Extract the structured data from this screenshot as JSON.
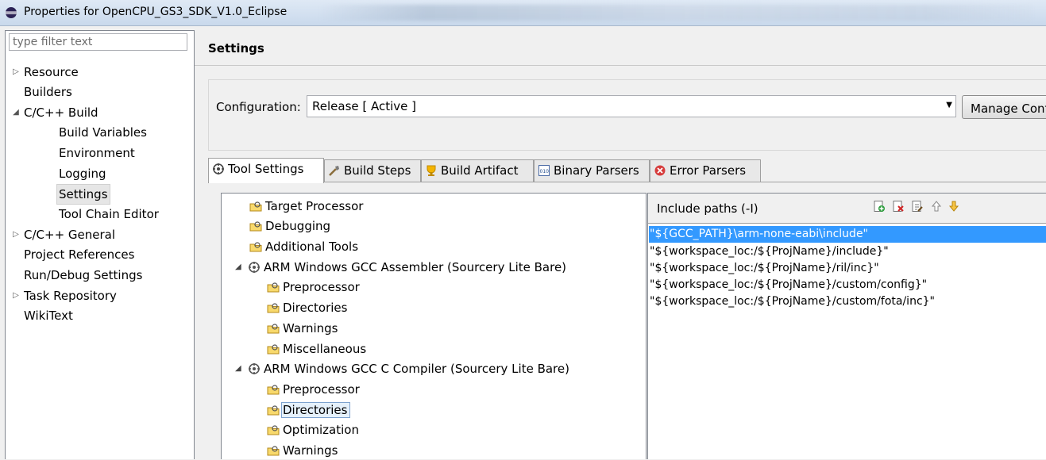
{
  "window": {
    "title": "Properties for OpenCPU_GS3_SDK_V1.0_Eclipse"
  },
  "filter": {
    "placeholder": "type filter text"
  },
  "nav": [
    {
      "label": "Resource",
      "arrow": "▷"
    },
    {
      "label": "Builders",
      "arrow": ""
    },
    {
      "label": "C/C++ Build",
      "arrow": "◢"
    },
    {
      "label": "Build Variables",
      "arrow": ""
    },
    {
      "label": "Environment",
      "arrow": ""
    },
    {
      "label": "Logging",
      "arrow": ""
    },
    {
      "label": "Settings",
      "arrow": "",
      "selected": true
    },
    {
      "label": "Tool Chain Editor",
      "arrow": ""
    },
    {
      "label": "C/C++ General",
      "arrow": "▷"
    },
    {
      "label": "Project References",
      "arrow": ""
    },
    {
      "label": "Run/Debug Settings",
      "arrow": ""
    },
    {
      "label": "Task Repository",
      "arrow": "▷"
    },
    {
      "label": "WikiText",
      "arrow": ""
    }
  ],
  "page": {
    "title": "Settings"
  },
  "config": {
    "label": "Configuration:",
    "value": "Release  [ Active ]",
    "manage_label": "Manage Configurations..."
  },
  "tabs": [
    {
      "label": "Tool Settings",
      "icon": "tool-settings-icon"
    },
    {
      "label": "Build Steps",
      "icon": "build-steps-icon"
    },
    {
      "label": "Build Artifact",
      "icon": "build-artifact-icon"
    },
    {
      "label": "Binary Parsers",
      "icon": "binary-parsers-icon"
    },
    {
      "label": "Error Parsers",
      "icon": "error-parsers-icon"
    }
  ],
  "tool_tree": [
    {
      "label": "Target Processor",
      "type": "option"
    },
    {
      "label": "Debugging",
      "type": "option"
    },
    {
      "label": "Additional Tools",
      "type": "option"
    },
    {
      "label": "ARM Windows GCC Assembler (Sourcery Lite Bare)",
      "type": "tool",
      "arrow": "◢"
    },
    {
      "label": "Preprocessor",
      "type": "option"
    },
    {
      "label": "Directories",
      "type": "option"
    },
    {
      "label": "Warnings",
      "type": "option"
    },
    {
      "label": "Miscellaneous",
      "type": "option"
    },
    {
      "label": "ARM Windows GCC C Compiler (Sourcery Lite Bare)",
      "type": "tool",
      "arrow": "◢"
    },
    {
      "label": "Preprocessor",
      "type": "option"
    },
    {
      "label": "Directories",
      "type": "option",
      "selected": true
    },
    {
      "label": "Optimization",
      "type": "option"
    },
    {
      "label": "Warnings",
      "type": "option"
    }
  ],
  "include_paths": {
    "label": "Include paths (-I)",
    "toolbar": [
      "add-path-icon",
      "delete-path-icon",
      "edit-path-icon",
      "move-up-icon",
      "move-down-icon"
    ],
    "items": [
      "\"${GCC_PATH}\\arm-none-eabi\\include\"",
      "\"${workspace_loc:/${ProjName}/include}\"",
      "\"${workspace_loc:/${ProjName}/ril/inc}\"",
      "\"${workspace_loc:/${ProjName}/custom/config}\"",
      "\"${workspace_loc:/${ProjName}/custom/fota/inc}\""
    ],
    "selected_index": 0
  },
  "colors": {
    "selection": "#3399ff",
    "tree_selection": "#e5f1fb"
  }
}
